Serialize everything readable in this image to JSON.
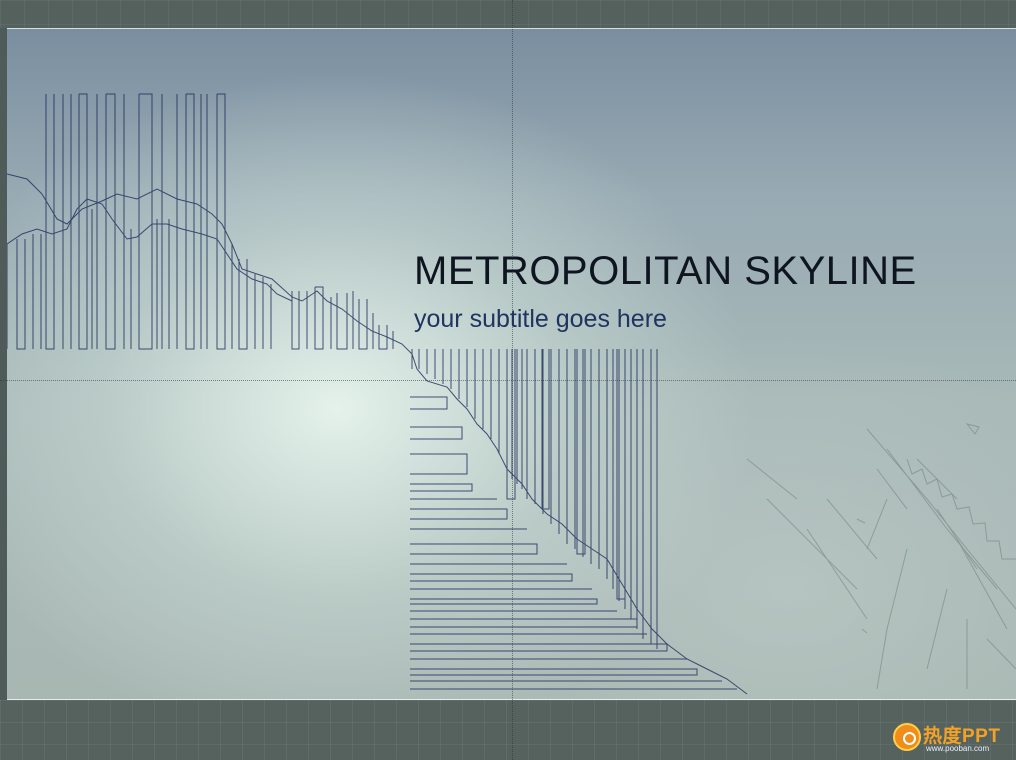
{
  "slide": {
    "title": "METROPOLITAN SKYLINE",
    "subtitle": "your subtitle goes here"
  },
  "watermark": {
    "name": "热度PPT",
    "url": "www.pooban.com"
  },
  "colors": {
    "line_art": "#1c2a5a",
    "title": "#0e1420",
    "subtitle": "#1f3460",
    "frame": "#55615d",
    "watermark_orange": "#f08c1a"
  }
}
